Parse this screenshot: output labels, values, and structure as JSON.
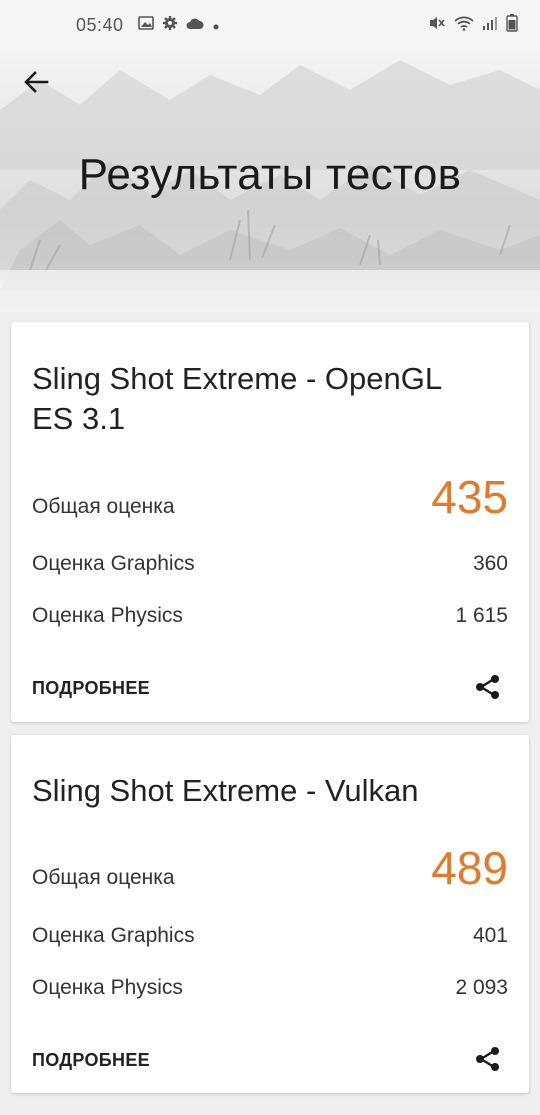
{
  "status_bar": {
    "time": "05:40",
    "icons": [
      "image-icon",
      "gear-icon",
      "cloud-icon",
      "dot-icon",
      "mute-icon",
      "wifi-icon",
      "signal-icon",
      "battery-icon"
    ]
  },
  "header": {
    "back_icon": "back-arrow-icon",
    "title": "Результаты тестов"
  },
  "results": [
    {
      "title": "Sling Shot Extreme - OpenGL ES 3.1",
      "overall_label": "Общая оценка",
      "overall_score": "435",
      "graphics_label": "Оценка Graphics",
      "graphics_score": "360",
      "physics_label": "Оценка Physics",
      "physics_score": "1 615",
      "details_label": "ПОДРОБНЕЕ",
      "share_icon": "share-icon"
    },
    {
      "title": "Sling Shot Extreme - Vulkan",
      "overall_label": "Общая оценка",
      "overall_score": "489",
      "graphics_label": "Оценка Graphics",
      "graphics_score": "401",
      "physics_label": "Оценка Physics",
      "physics_score": "2 093",
      "details_label": "ПОДРОБНЕЕ",
      "share_icon": "share-icon"
    }
  ],
  "colors": {
    "accent": "#e4792a",
    "background": "#efefef",
    "card": "#ffffff"
  }
}
